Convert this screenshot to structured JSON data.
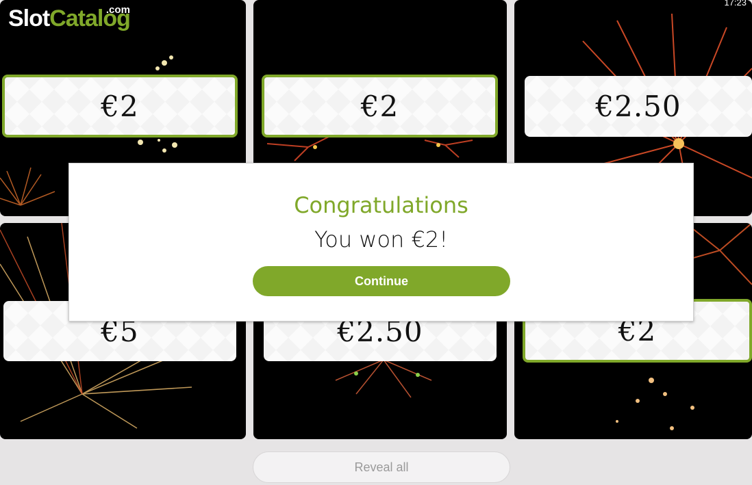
{
  "logo": {
    "slot": "Slot",
    "catalog": "Catalog",
    "dotcom": ".com"
  },
  "clock": "17:23",
  "prizes": [
    "€2",
    "€2",
    "€2.50",
    "€5",
    "€2.50",
    "€2"
  ],
  "winning_cards": [
    0,
    1,
    5
  ],
  "modal": {
    "title": "Congratulations",
    "message": "You won €2!",
    "continue_label": "Continue"
  },
  "reveal_all_label": "Reveal all",
  "colors": {
    "accent": "#80a82a",
    "background": "#e6e4e5",
    "card": "#000000"
  }
}
